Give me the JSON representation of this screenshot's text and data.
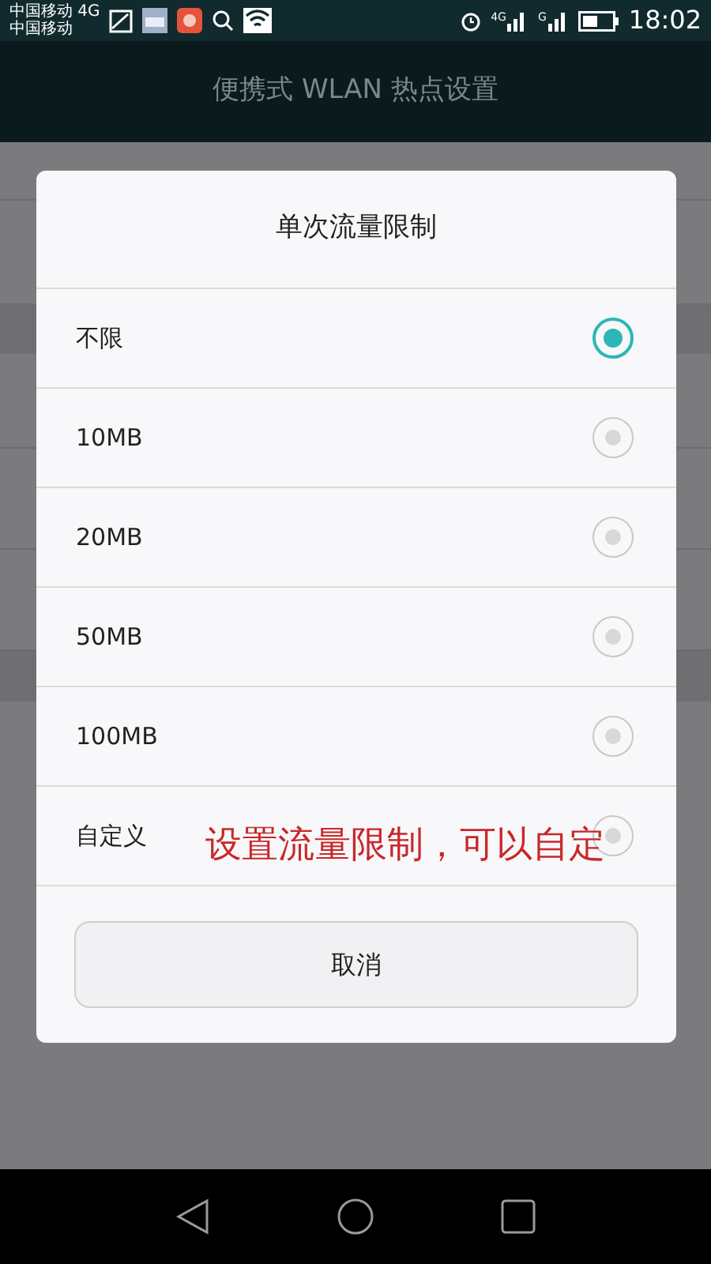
{
  "status_bar": {
    "carrier_1": "中国移动 4G",
    "carrier_2": "中国移动",
    "network_1": "4G",
    "network_2": "G",
    "time": "18:02"
  },
  "app_bar": {
    "title": "便携式 WLAN 热点设置"
  },
  "dialog": {
    "title": "单次流量限制",
    "options": [
      {
        "label": "不限",
        "selected": true
      },
      {
        "label": "10MB",
        "selected": false
      },
      {
        "label": "20MB",
        "selected": false
      },
      {
        "label": "50MB",
        "selected": false
      },
      {
        "label": "100MB",
        "selected": false
      },
      {
        "label": "自定义",
        "selected": false
      }
    ],
    "cancel": "取消"
  },
  "annotation": "设置流量限制，可以自定"
}
